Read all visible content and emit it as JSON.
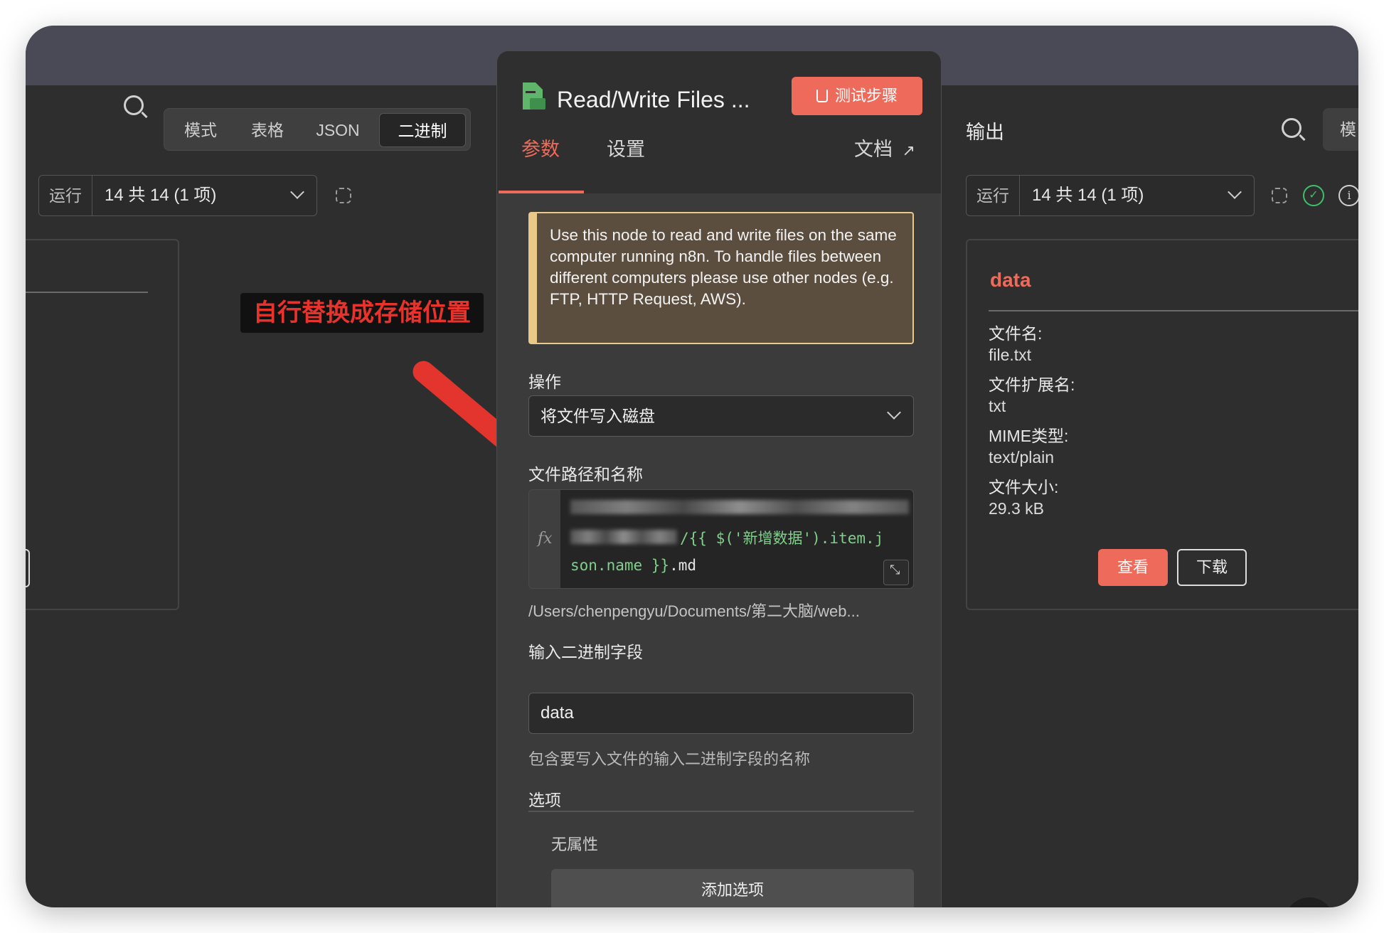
{
  "left_panel": {
    "tabs": [
      "模式",
      "表格",
      "JSON",
      "二进制"
    ],
    "active_tab": "二进制",
    "run_label": "运行",
    "run_value": "14 共 14 (1 项)"
  },
  "node": {
    "title": "Read/Write Files ...",
    "test_button": "测试步骤",
    "tabs": {
      "params": "参数",
      "settings": "设置",
      "docs": "文档"
    },
    "notice": "Use this node to read and write files on the same computer running n8n. To handle files between different computers please use other nodes (e.g. FTP, HTTP Request, AWS).",
    "operation_label": "操作",
    "operation_value": "将文件写入磁盘",
    "file_path_label": "文件路径和名称",
    "expr_part1": "/{{ $('新增数据').item.j",
    "expr_part2": "son.name }}",
    "expr_suffix": ".md",
    "expr_fx": "fx",
    "resolved_path": "/Users/chenpengyu/Documents/第二大脑/web...",
    "binary_field_label": "输入二进制字段",
    "binary_field_value": "data",
    "binary_field_hint": "包含要写入文件的输入二进制字段的名称",
    "options_label": "选项",
    "no_props": "无属性",
    "add_option": "添加选项"
  },
  "output": {
    "title": "输出",
    "partial_tab": "模",
    "run_label": "运行",
    "run_value": "14 共 14 (1 项)",
    "card_title": "data",
    "fields": [
      {
        "key": "文件名:",
        "value": "file.txt"
      },
      {
        "key": "文件扩展名:",
        "value": "txt"
      },
      {
        "key": "MIME类型:",
        "value": "text/plain"
      },
      {
        "key": "文件大小:",
        "value": "29.3 kB"
      }
    ],
    "view_button": "查看",
    "download_button": "下载"
  },
  "annotation": {
    "text": "自行替换成存储位置"
  },
  "colors": {
    "accent": "#ee6b5b",
    "annotation": "#e3342d",
    "notice_border": "#e8c988",
    "success": "#3fbf6a"
  }
}
